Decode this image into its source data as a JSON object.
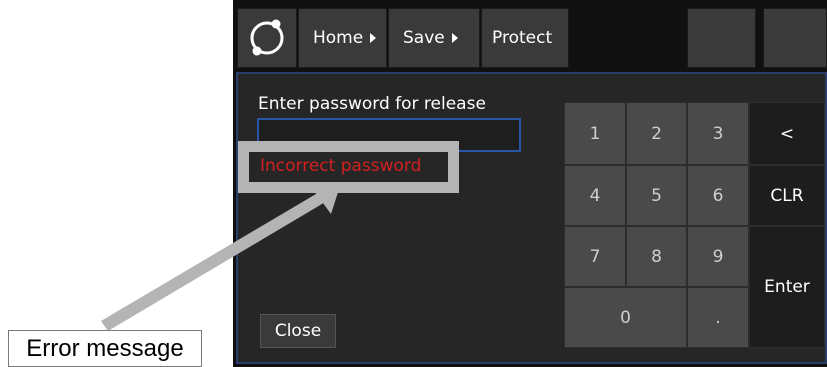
{
  "toolbar": {
    "home_label": "Home",
    "save_label": "Save",
    "protect_label": "Protect"
  },
  "dialog": {
    "prompt": "Enter password for release",
    "password_value": "",
    "error_message": "Incorrect password",
    "close_label": "Close"
  },
  "keypad": {
    "k1": "1",
    "k2": "2",
    "k3": "3",
    "back": "<",
    "k4": "4",
    "k5": "5",
    "k6": "6",
    "clear": "CLR",
    "k7": "7",
    "k8": "8",
    "k9": "9",
    "enter": "Enter",
    "k0": "0",
    "dot": "."
  },
  "annotation": {
    "label": "Error message"
  },
  "colors": {
    "error": "#d42020",
    "field_border": "#2a56a8",
    "panel_border": "#2a3e6e"
  }
}
